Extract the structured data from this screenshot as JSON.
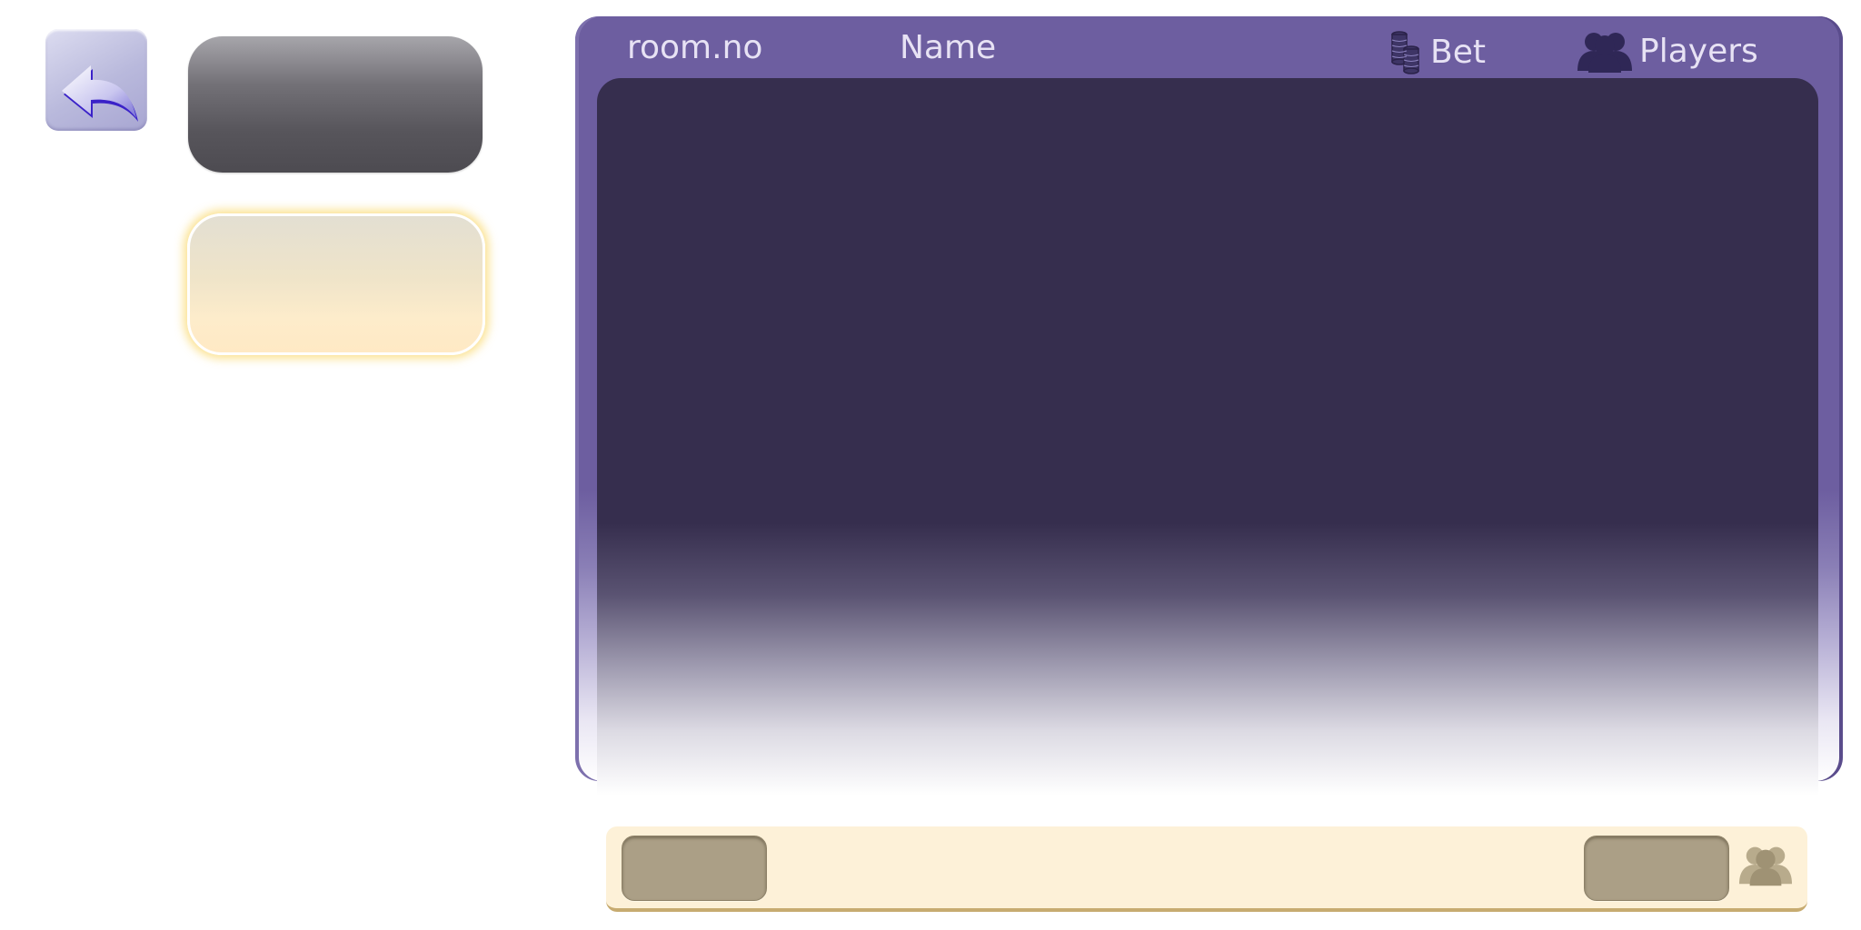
{
  "header": {
    "room_label": "room.no",
    "name_label": "Name",
    "bet_label": "Bet",
    "players_label": "Players"
  },
  "icons": {
    "back": "back-arrow-icon",
    "bet": "coin-stack-icon",
    "players": "players-group-icon",
    "bottom_players": "players-group-icon"
  },
  "colors": {
    "panel_frame": "#6d5ea0",
    "list_background": "#362e4e",
    "header_text": "#e7e2f4",
    "bottom_bar": "#fdf1d8",
    "bottom_buttons": "#ab9f86",
    "tab_highlight_glow": "#fad86e"
  },
  "room_list": []
}
